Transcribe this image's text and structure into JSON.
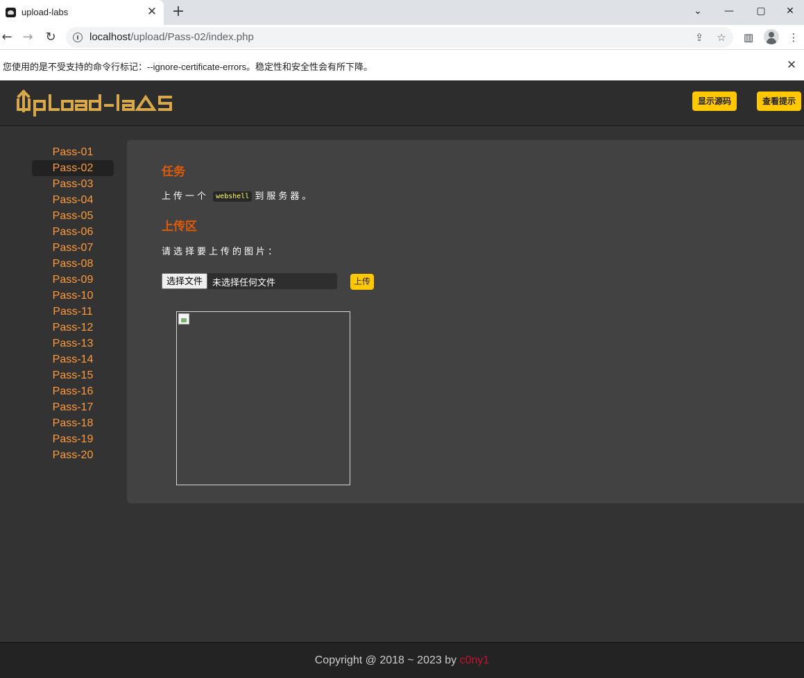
{
  "browser": {
    "tab_title": "upload-labs",
    "tab_close": "✕",
    "new_tab": "+",
    "window": {
      "minimize": "—",
      "maximize": "▢",
      "close": "✕",
      "dropdown": "⌄"
    },
    "nav": {
      "back": "←",
      "forward": "→",
      "reload": "↻"
    },
    "url_host": "localhost",
    "url_path": "/upload/Pass-02/index.php",
    "infobar_text": "您使用的是不受支持的命令行标记：--ignore-certificate-errors。稳定性和安全性会有所下降。",
    "infobar_close": "✕",
    "icons": {
      "share": "⇪",
      "bookmark": "☆",
      "side_panel": "▥",
      "menu": "⋮"
    }
  },
  "header": {
    "logo_alt": "UpLoad-labs",
    "show_source_label": "显示源码",
    "show_hint_label": "查看提示",
    "button_color": "#ffc800"
  },
  "sidebar": {
    "active_index": 1,
    "items": [
      {
        "label": "Pass-01"
      },
      {
        "label": "Pass-02"
      },
      {
        "label": "Pass-03"
      },
      {
        "label": "Pass-04"
      },
      {
        "label": "Pass-05"
      },
      {
        "label": "Pass-06"
      },
      {
        "label": "Pass-07"
      },
      {
        "label": "Pass-08"
      },
      {
        "label": "Pass-09"
      },
      {
        "label": "Pass-10"
      },
      {
        "label": "Pass-11"
      },
      {
        "label": "Pass-12"
      },
      {
        "label": "Pass-13"
      },
      {
        "label": "Pass-14"
      },
      {
        "label": "Pass-15"
      },
      {
        "label": "Pass-16"
      },
      {
        "label": "Pass-17"
      },
      {
        "label": "Pass-18"
      },
      {
        "label": "Pass-19"
      },
      {
        "label": "Pass-20"
      }
    ]
  },
  "main": {
    "task_title": "任务",
    "task_prefix": "上传一个",
    "task_code": "webshell",
    "task_suffix": "到服务器。",
    "upload_title": "上传区",
    "upload_prompt": "请选择要上传的图片：",
    "file_button_label": "选择文件",
    "file_status": "未选择任何文件",
    "submit_label": "上传"
  },
  "footer": {
    "copyright": "Copyright @ 2018 ~ 2023 by ",
    "author": "c0ny1"
  },
  "colors": {
    "accent_orange": "#e05a0a",
    "link_orange": "#ff9a3c",
    "author_red": "#c8102e",
    "logo_gold": "#d9a84a"
  }
}
